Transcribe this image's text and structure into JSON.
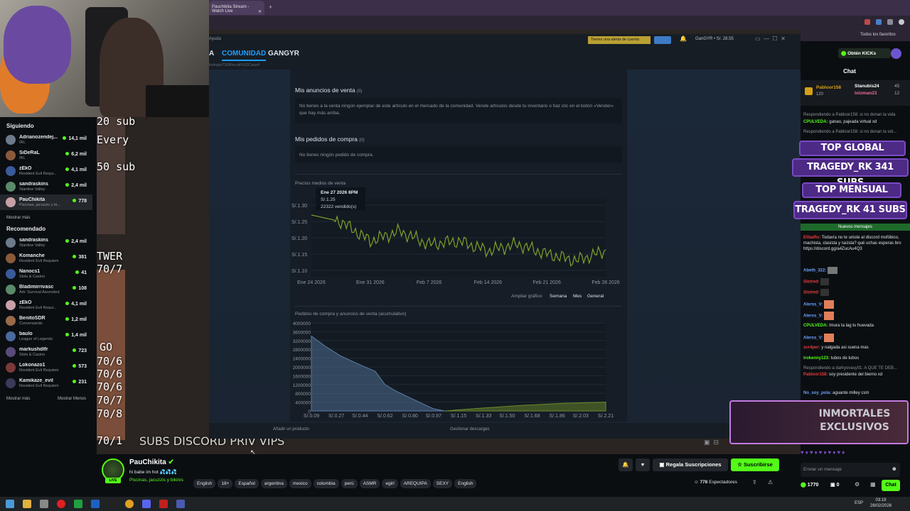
{
  "browser": {
    "tab_title": "Pauchikita Stream - Watch Live",
    "bookmarks": "Todos los favoritos"
  },
  "stream": {
    "overlays": [
      "20 sub",
      "Every",
      "50 sub",
      "TWER",
      "70/7",
      "GO",
      "70/6",
      "70/6",
      "70/6",
      "70/7",
      "70/8",
      "70/1"
    ],
    "banner": "SUBS DISCORD PRIV VIPS"
  },
  "sidebar": {
    "following_title": "Siguiendo",
    "following": [
      {
        "name": "Adrianozendej...",
        "category": "IRL",
        "viewers": "14,1 mil"
      },
      {
        "name": "SiDeRaL",
        "category": "IRL",
        "viewers": "6,2 mil"
      },
      {
        "name": "zEkO",
        "category": "Resident Evil Requi...",
        "viewers": "4,1 mil"
      },
      {
        "name": "sandraskins",
        "category": "Stardew Valley",
        "viewers": "2,4 mil"
      },
      {
        "name": "PauChikita",
        "category": "Piscinas, jacuzzis y bi...",
        "viewers": "778"
      }
    ],
    "show_more": "Mostrar más",
    "recommended_title": "Recomendado",
    "recommended": [
      {
        "name": "sandraskins",
        "category": "Stardew Valley",
        "viewers": "2,4 mil"
      },
      {
        "name": "Komanche",
        "category": "Resident Evil Requiem",
        "viewers": "381"
      },
      {
        "name": "Nanocs1",
        "category": "Slots & Casino",
        "viewers": "41"
      },
      {
        "name": "Bladimirrivasc",
        "category": "Ark: Survival Ascended",
        "viewers": "108"
      },
      {
        "name": "zEkO",
        "category": "Resident Evil Requi...",
        "viewers": "4,1 mil"
      },
      {
        "name": "BenitoSDR",
        "category": "Conversando",
        "viewers": "1,2 mil"
      },
      {
        "name": "baulo",
        "category": "League of Legends",
        "viewers": "1,4 mil"
      },
      {
        "name": "markushdlfr",
        "category": "Slots & Casino",
        "viewers": "723"
      },
      {
        "name": "Lokonazo1",
        "category": "Resident Evil Requiem",
        "viewers": "573"
      },
      {
        "name": "Kamikaze_evil",
        "category": "Resident Evil Requiem",
        "viewers": "231"
      }
    ],
    "show_more2": "Mostrar más",
    "show_less": "Mostrar Menos"
  },
  "steam": {
    "help": "Ayuda",
    "nav": [
      "A",
      "COMUNIDAD",
      "GANGYR"
    ],
    "url": "listings/730/Recoil%20Case#",
    "alert_btn": "Tienes una alerta de cuenta",
    "user": "GanGYR • S/. 28.55",
    "listings_title": "Mis anuncios de venta",
    "listings_count": "(0)",
    "listings_text": "No tienes a la venta ningún ejemplar de este artículo en el mercado de la comunidad. Vende artículos desde tu inventario o haz clic en el botón «Vender» que hay más arriba.",
    "orders_title": "Mis pedidos de compra",
    "orders_count": "(0)",
    "orders_text": "No tienes ningún pedido de compra.",
    "price_title": "Precios medios de venta",
    "zoom_label": "Ampliar gráfico",
    "zoom_week": "Semana",
    "zoom_month": "Mes",
    "zoom_all": "General",
    "depth_title": "Pedidos de compra y anuncios de venta (acumulativo)",
    "add_product": "Añadir un producto",
    "downloads": "Gestionar descargas"
  },
  "chart_data": [
    {
      "type": "line",
      "title": "Precios medios de venta",
      "x": [
        "Ene 24 2026",
        "Ene 27 2026",
        "Ene 31 2026",
        "Feb 3 2026",
        "Feb 7 2026",
        "Feb 10 2026",
        "Feb 14 2026",
        "Feb 17 2026",
        "Feb 21 2026",
        "Feb 24 2026",
        "Feb 28 2026"
      ],
      "values": [
        1.27,
        1.25,
        1.19,
        1.22,
        1.18,
        1.19,
        1.16,
        1.18,
        1.15,
        1.13,
        1.16
      ],
      "ytick_labels": [
        "S/.1.30",
        "S/.1.25",
        "S/.1.20",
        "S/.1.15",
        "S/.1.10"
      ],
      "xtick_labels": [
        "Ene 24 2026",
        "Ene 31 2026",
        "Feb 7 2026",
        "Feb 14 2026",
        "Feb 21 2026",
        "Feb 28 2026"
      ],
      "ylim": [
        1.08,
        1.32
      ],
      "tooltip": {
        "date": "Ene 27 2026 8PM",
        "price": "S/.1.25",
        "volume": "22322 vendido(s)"
      },
      "color": "#7fa02a"
    },
    {
      "type": "area",
      "title": "Pedidos de compra y anuncios de venta (acumulativo)",
      "xtick_labels": [
        "S/.0.09",
        "S/.0.27",
        "S/.0.44",
        "S/.0.62",
        "S/.0.80",
        "S/.0.97",
        "S/.1.15",
        "S/.1.33",
        "S/.1.50",
        "S/.1.68",
        "S/.1.86",
        "S/.2.03",
        "S/.2.21"
      ],
      "ytick_labels": [
        "4000000",
        "3600000",
        "3200000",
        "2800000",
        "2400000",
        "2000000",
        "1600000",
        "1200000",
        "800000",
        "400000",
        "0"
      ],
      "ylim": [
        0,
        4000000
      ],
      "series": [
        {
          "x": [
            0.09,
            0.2,
            0.3,
            0.44,
            0.55,
            0.62,
            0.7,
            0.8,
            0.9,
            0.97,
            1.05
          ],
          "values": [
            3400000,
            2900000,
            2500000,
            2100000,
            1800000,
            1200000,
            900000,
            600000,
            300000,
            100000,
            0
          ],
          "color": "#5a7ea8"
        },
        {
          "x": [
            1.05,
            1.3,
            1.6,
            1.9,
            2.21
          ],
          "values": [
            0,
            120000,
            250000,
            350000,
            400000
          ],
          "color": "#6c8a2a"
        }
      ]
    }
  ],
  "kick": {
    "get_kicks": "Obtén KICKs",
    "chat_title": "Chat",
    "leaderboard": [
      {
        "name": "Pabloor158",
        "n": ""
      },
      {
        "name": "Stanubis24",
        "n": "45"
      },
      {
        "name": "lolzman23",
        "n": "12"
      }
    ],
    "gift_count": "120",
    "banners": [
      "TOP GLOBAL",
      "TRAGEDY_RK 341 SUBS",
      "TOP MENSUAL",
      "TRAGEDY_RK 41 SUBS"
    ],
    "new_messages": "Nuevos mensajes",
    "messages": [
      {
        "user": "",
        "text": "Respondiendo a Pabloor158: si no donan la vida"
      },
      {
        "user": "CPULVEDA:",
        "text": "ganao, pajeada virtual xd"
      },
      {
        "user": "",
        "text": "Respondiendo a Pabloor158: si no donan la vid..."
      },
      {
        "user": "ElibaRo:",
        "text": "Todavía no te uniste al discord mofóbico, machista, clasista y racista? qué uchas esperas bro https://discord.gg/a4ZucAu4Q3"
      },
      {
        "user": "Abeth_322:",
        "text": ""
      },
      {
        "user": "Slotred:",
        "text": ""
      },
      {
        "user": "Slotred:",
        "text": ""
      },
      {
        "user": "Alerss_V:",
        "text": ""
      },
      {
        "user": "Alerss_V:",
        "text": ""
      },
      {
        "user": "CPULVEDA:",
        "text": "lmura ta lag tu huevada"
      },
      {
        "user": "Alerss_V:",
        "text": ""
      },
      {
        "user": "scr4per:",
        "text": "y nalgada asi suena mas"
      },
      {
        "user": "irokenny123:",
        "text": "tubos de tubos"
      },
      {
        "user": "",
        "text": "Respondiendo a darkyovasy01: A QUE TE DEB..."
      },
      {
        "user": "Pabloor158:",
        "text": "soy presidente del bierno xd"
      },
      {
        "user": "No_soy_pola:",
        "text": "aguante milley csm"
      }
    ],
    "promo": "INMORTALES EXCLUSIVOS",
    "placeholder": "Enviar un mensaje",
    "kicks": "1770",
    "gifts": "0",
    "chat_btn": "Chat"
  },
  "channel": {
    "name": "PauChikita",
    "title": "hi babe im hot 💦💦💦",
    "category": "Piscinas, jacuzzis y bikinis",
    "tags": [
      "English",
      "18+",
      "Español",
      "argentina",
      "mexico",
      "colombia",
      "perú",
      "ASMR",
      "egirl",
      "AREQUIPA",
      "SEXY",
      "English"
    ],
    "gift_btn": "Regala Suscripciones",
    "sub_btn": "Suscribirse",
    "viewers": "778",
    "viewers_label": "Espectadores"
  },
  "taskbar": {
    "time": "03:19",
    "date": "28/02/2026",
    "lang": "ESP"
  }
}
